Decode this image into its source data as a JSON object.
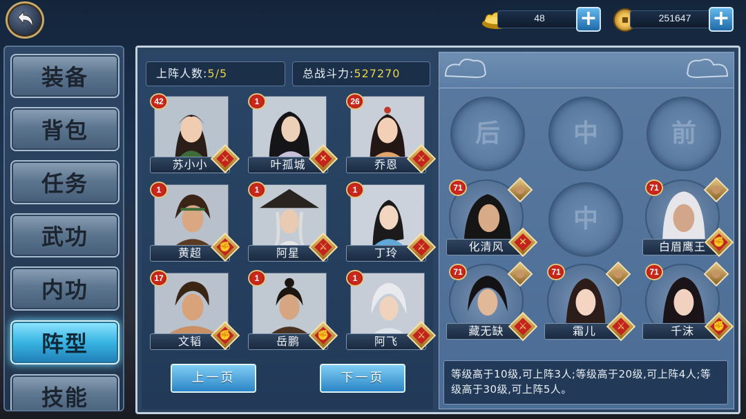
{
  "top_bar": {
    "gold": {
      "value": "48",
      "icon": "gold-ingot-icon"
    },
    "coins": {
      "value": "251647",
      "icon": "copper-coin-icon"
    }
  },
  "sidebar": {
    "items": [
      {
        "label": "装备",
        "active": false
      },
      {
        "label": "背包",
        "active": false
      },
      {
        "label": "任务",
        "active": false
      },
      {
        "label": "武功",
        "active": false
      },
      {
        "label": "内功",
        "active": false
      },
      {
        "label": "阵型",
        "active": true
      },
      {
        "label": "技能",
        "active": false
      }
    ]
  },
  "stats": {
    "deployed_label": "上阵人数:",
    "deployed_value": "5/5",
    "power_label": "总战斗力:",
    "power_value": "527270"
  },
  "heroes": [
    {
      "name": "苏小小",
      "level": "42",
      "role": "sword"
    },
    {
      "name": "叶孤城",
      "level": "1",
      "role": "swords"
    },
    {
      "name": "乔恩",
      "level": "26",
      "role": "sword"
    },
    {
      "name": "黄超",
      "level": "1",
      "role": "fist"
    },
    {
      "name": "阿星",
      "level": "1",
      "role": "sword"
    },
    {
      "name": "丁玲",
      "level": "1",
      "role": "sword"
    },
    {
      "name": "文韬",
      "level": "17",
      "role": "fist"
    },
    {
      "name": "岳鹏",
      "level": "1",
      "role": "fist"
    },
    {
      "name": "阿飞",
      "level": "1",
      "role": "sword"
    }
  ],
  "pagination": {
    "prev": "上一页",
    "next": "下一页"
  },
  "formation": {
    "empty_slots": [
      "后",
      "中",
      "前",
      "中"
    ],
    "placed": [
      {
        "name": "化清风",
        "level": "71",
        "role": "swords"
      },
      {
        "name": "白眉鹰王",
        "level": "71",
        "role": "fist"
      },
      {
        "name": "藏无缺",
        "level": "71",
        "role": "sword"
      },
      {
        "name": "霜儿",
        "level": "71",
        "role": "sword"
      },
      {
        "name": "千沫",
        "level": "71",
        "role": "fist"
      }
    ]
  },
  "info_text": "等级高于10级,可上阵3人;等级高于20级,可上阵4人;等级高于30级,可上阵5人。"
}
